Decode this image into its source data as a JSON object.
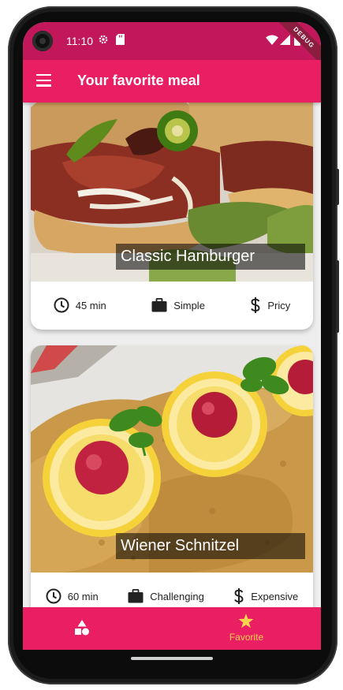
{
  "status_bar": {
    "time": "11:10",
    "debug_banner": "DEBUG"
  },
  "app_bar": {
    "title": "Your favorite meal"
  },
  "meals": [
    {
      "title": "Classic Hamburger",
      "duration": "45 min",
      "complexity": "Simple",
      "affordability": "Pricy"
    },
    {
      "title": "Wiener Schnitzel",
      "duration": "60 min",
      "complexity": "Challenging",
      "affordability": "Expensive"
    }
  ],
  "bottom_nav": {
    "categories_icon": "category-icon",
    "favorites_label": "Favorite",
    "active_color": "#ffd54f"
  },
  "colors": {
    "primary": "#e91e63",
    "status_bar": "#c2185b",
    "accent": "#ffd54f"
  }
}
